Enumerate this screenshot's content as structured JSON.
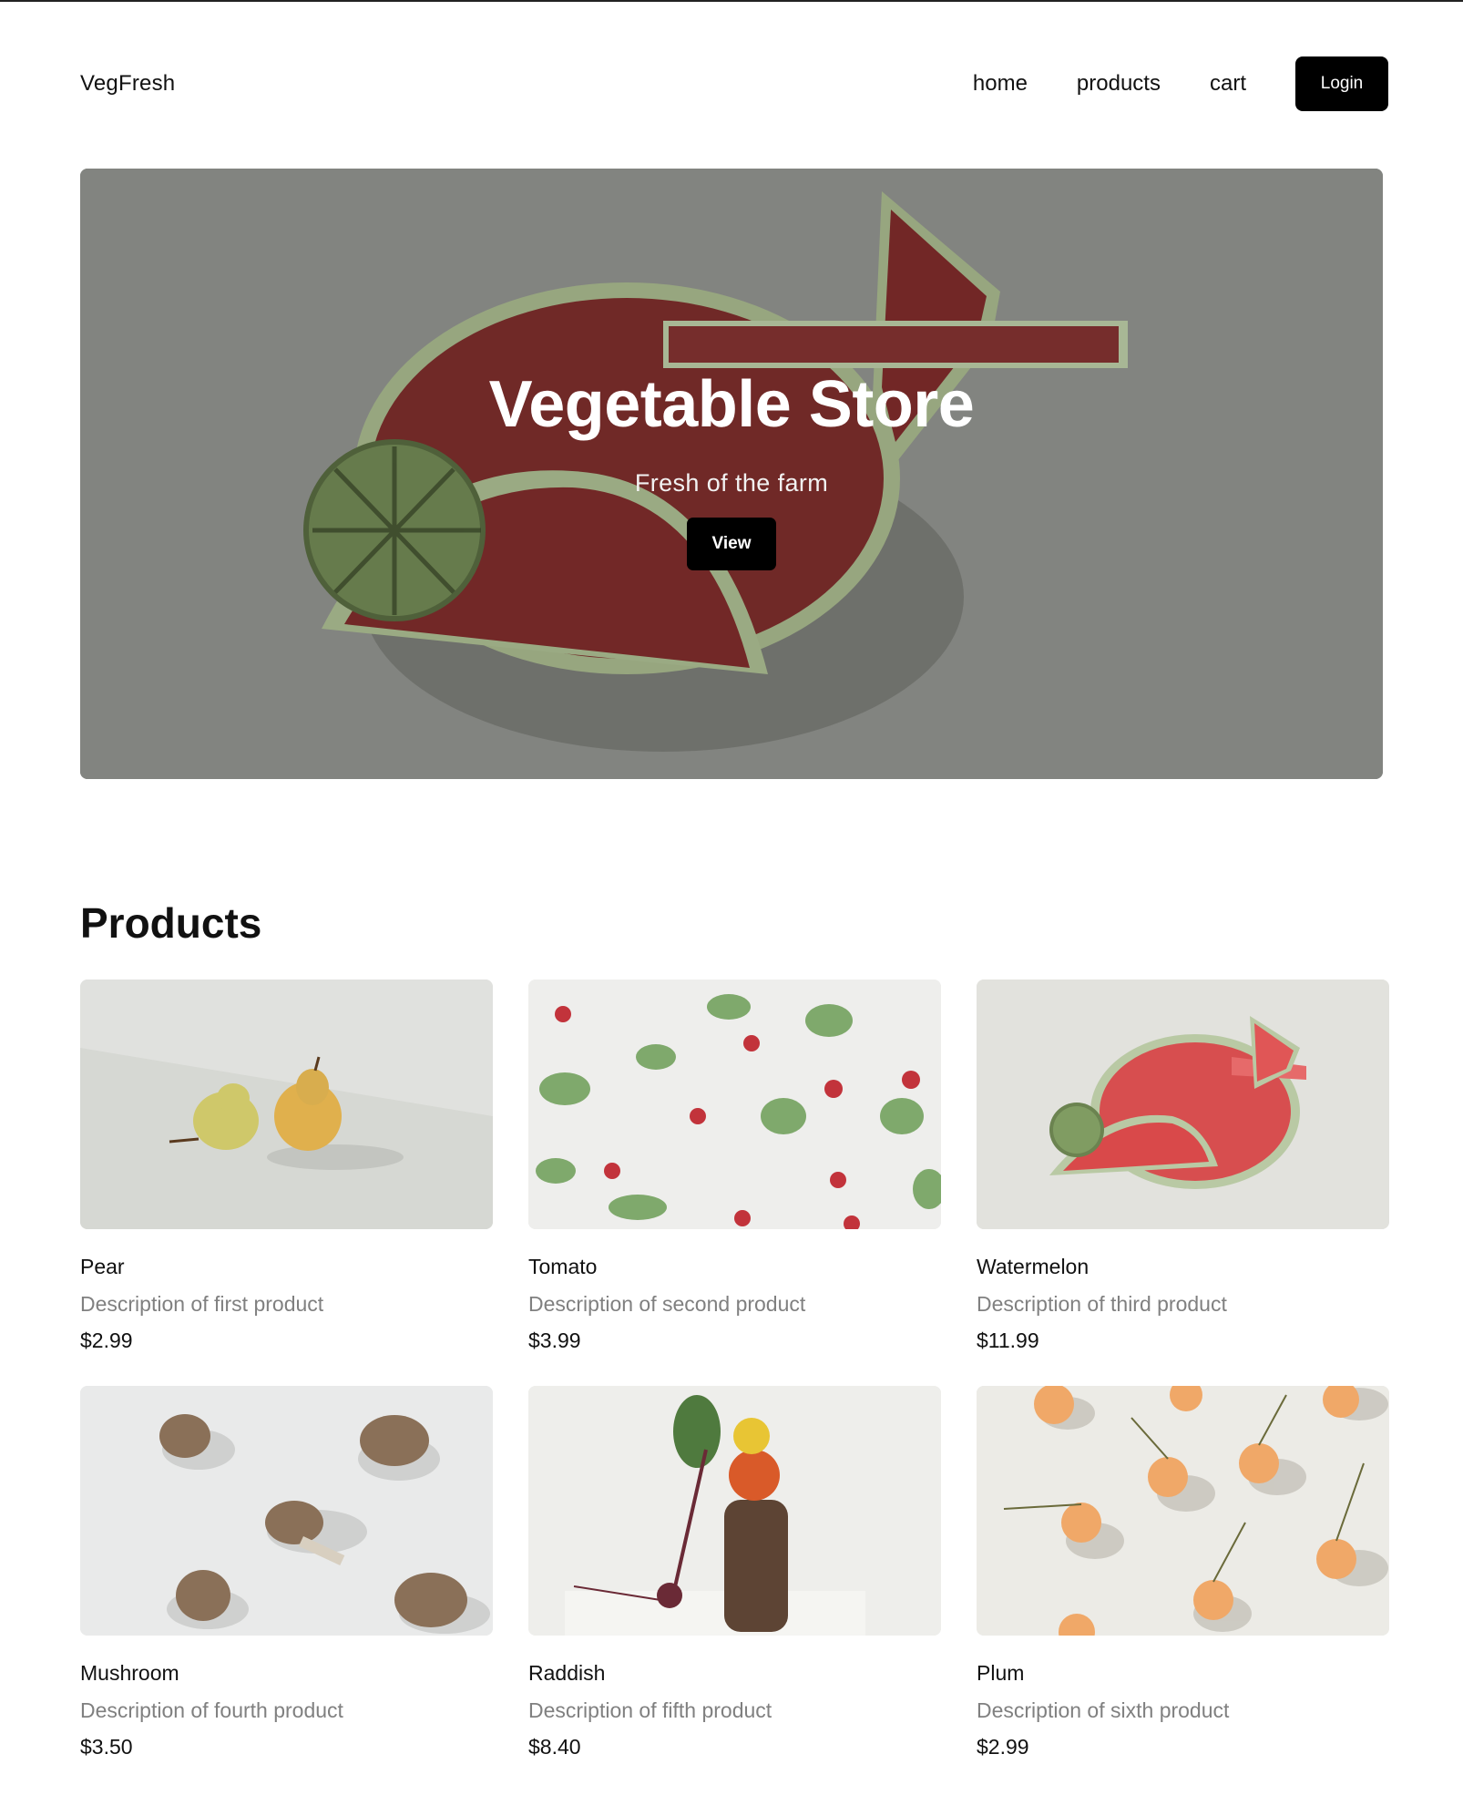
{
  "header": {
    "brand": "VegFresh",
    "nav": [
      "home",
      "products",
      "cart"
    ],
    "login_label": "Login"
  },
  "hero": {
    "title": "Vegetable Store",
    "subtitle": "Fresh of the farm",
    "button_label": "View"
  },
  "products": {
    "title": "Products",
    "items": [
      {
        "name": "Pear",
        "description": "Description of first product",
        "price": "$2.99",
        "image": "pear-photo"
      },
      {
        "name": "Tomato",
        "description": "Description of second product",
        "price": "$3.99",
        "image": "radish-photo"
      },
      {
        "name": "Watermelon",
        "description": "Description of third product",
        "price": "$11.99",
        "image": "watermelon-photo"
      },
      {
        "name": "Mushroom",
        "description": "Description of fourth product",
        "price": "$3.50",
        "image": "mushroom-photo"
      },
      {
        "name": "Raddish",
        "description": "Description of fifth product",
        "price": "$8.40",
        "image": "beet-photo"
      },
      {
        "name": "Plum",
        "description": "Description of sixth product",
        "price": "$2.99",
        "image": "cherry-photo"
      }
    ]
  },
  "colors": {
    "button": "#000000",
    "muted_text": "#808080",
    "watermelon_red": "#c0383a"
  }
}
